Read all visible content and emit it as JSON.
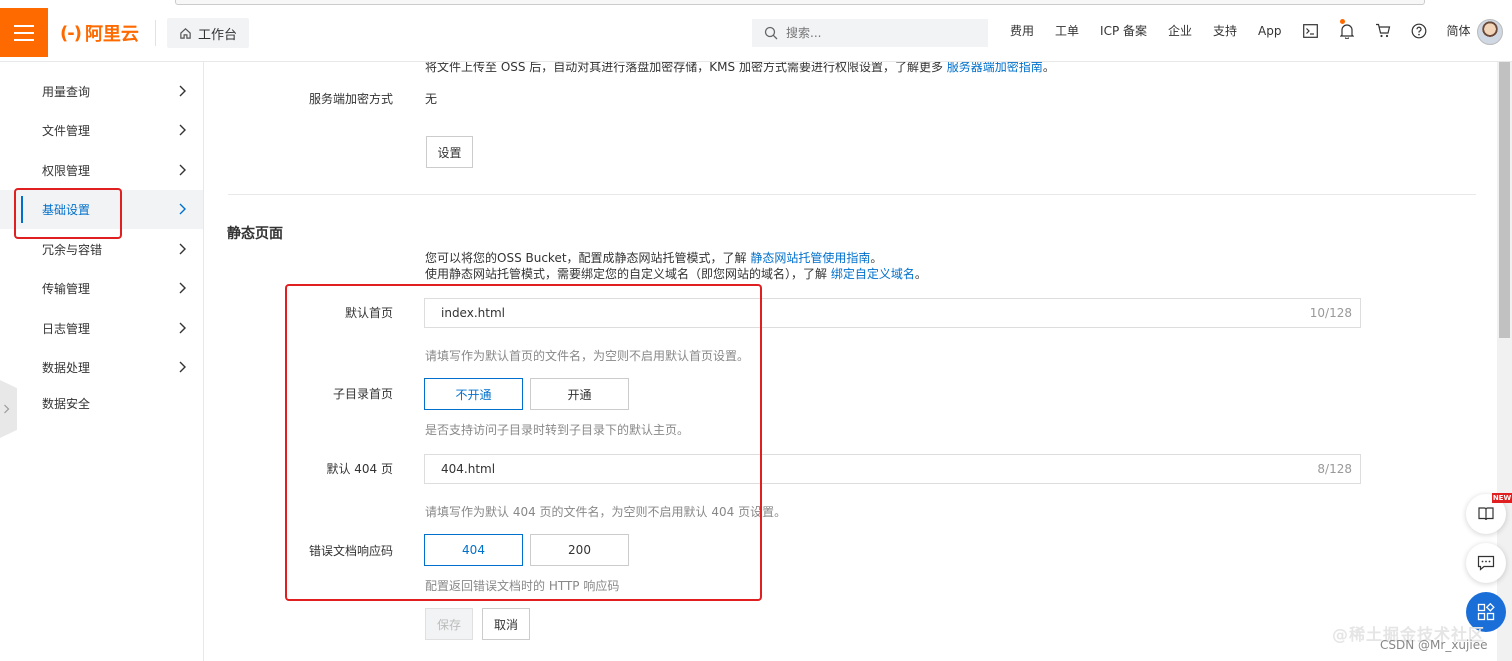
{
  "topbar": {
    "brand": "阿里云",
    "logo_mark": "(-)",
    "workbench_label": "工作台",
    "search_placeholder": "搜索...",
    "nav_items": [
      "费用",
      "工单",
      "ICP 备案",
      "企业",
      "支持",
      "App"
    ],
    "language": "简体",
    "icons": [
      "terminal-icon",
      "bell-icon",
      "cart-icon",
      "help-icon"
    ]
  },
  "sidebar": {
    "items": [
      {
        "label": "用量查询",
        "has_chevron": true
      },
      {
        "label": "文件管理",
        "has_chevron": true
      },
      {
        "label": "权限管理",
        "has_chevron": true
      },
      {
        "label": "基础设置",
        "has_chevron": true,
        "active": true
      },
      {
        "label": "冗余与容错",
        "has_chevron": true
      },
      {
        "label": "传输管理",
        "has_chevron": true
      },
      {
        "label": "日志管理",
        "has_chevron": true
      },
      {
        "label": "数据处理",
        "has_chevron": true
      },
      {
        "label": "数据安全",
        "has_chevron": false
      }
    ]
  },
  "encryption": {
    "desc_prefix": "将文件上传至 OSS 后，自动对其进行落盘加密存储，KMS 加密方式需要进行权限设置，了解更多",
    "desc_link": "服务器端加密指南",
    "desc_suffix": "。",
    "method_label": "服务端加密方式",
    "method_value": "无",
    "settings_button": "设置"
  },
  "static_page": {
    "title": "静态页面",
    "intro_line1_prefix": "您可以将您的OSS Bucket，配置成静态网站托管模式，了解",
    "intro_line1_link": "静态网站托管使用指南",
    "intro_line1_suffix": "。",
    "intro_line2_prefix": "使用静态网站托管模式，需要绑定您的自定义域名（即您网站的域名），了解",
    "intro_line2_link": "绑定自定义域名",
    "intro_line2_suffix": "。",
    "default_home_label": "默认首页",
    "default_home_value": "index.html",
    "default_home_count": "10/128",
    "default_home_hint": "请填写作为默认首页的文件名，为空则不启用默认首页设置。",
    "subdir_label": "子目录首页",
    "subdir_off": "不开通",
    "subdir_on": "开通",
    "subdir_hint": "是否支持访问子目录时转到子目录下的默认主页。",
    "default_404_label": "默认 404 页",
    "default_404_value": "404.html",
    "default_404_count": "8/128",
    "default_404_hint": "请填写作为默认 404 页的文件名，为空则不启用默认 404 页设置。",
    "error_code_label": "错误文档响应码",
    "error_code_404": "404",
    "error_code_200": "200",
    "error_code_hint": "配置返回错误文档时的 HTTP 响应码",
    "save_button": "保存",
    "cancel_button": "取消"
  },
  "floating": {
    "new_badge": "NEW"
  },
  "watermark": {
    "line1": "@稀土掘金技术社区",
    "line2": "CSDN @Mr_xujiee"
  },
  "colors": {
    "brand_orange": "#ff6a00",
    "link_blue": "#0070cc",
    "annotation_red": "#e02020"
  }
}
